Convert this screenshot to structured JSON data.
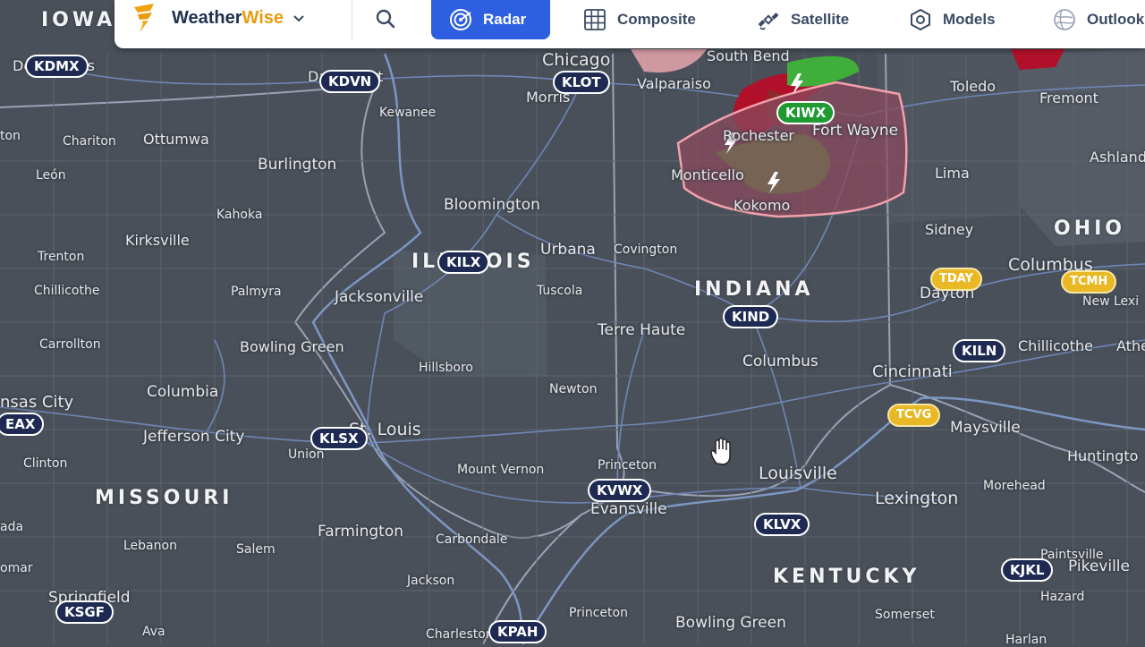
{
  "app": {
    "brand_part1": "Weather",
    "brand_part2": "Wise",
    "accent": "#2e5fe0",
    "brand_orange": "#e99b0e"
  },
  "nav": {
    "tabs": [
      {
        "label": "Radar",
        "icon": "radar-icon",
        "active": true
      },
      {
        "label": "Composite",
        "icon": "grid-icon"
      },
      {
        "label": "Satellite",
        "icon": "satellite-icon"
      },
      {
        "label": "Models",
        "icon": "models-icon"
      },
      {
        "label": "Outlook",
        "icon": "outlook-icon"
      }
    ]
  },
  "map": {
    "states": {
      "iowa": "IOWA",
      "illinois": "ILLINOIS",
      "indiana": "INDIANA",
      "ohio": "OHIO",
      "missouri": "MISSOURI",
      "kentucky": "KENTUCKY"
    },
    "cities": {
      "des_moines": "Des Moines",
      "davenport": "Davenport",
      "chicago": "Chicago",
      "south_bend": "South Bend",
      "valparaiso": "Valparaiso",
      "morris": "Morris",
      "toledo": "Toledo",
      "fremont": "Fremont",
      "kewanee": "Kewanee",
      "chariton": "Chariton",
      "ottumwa": "Ottumwa",
      "leon": "León",
      "burlington": "Burlington",
      "rochester": "Rochester",
      "fort_wayne": "Fort Wayne",
      "monticello": "Monticello",
      "kokomo": "Kokomo",
      "lima": "Lima",
      "ashland": "Ashland",
      "bloomington": "Bloomington",
      "kahoka": "Kahoka",
      "kirksville": "Kirksville",
      "trenton": "Trenton",
      "urbana": "Urbana",
      "covington": "Covington",
      "sidney": "Sidney",
      "columbus_oh": "Columbus",
      "chillicothe_mo": "Chillicothe",
      "palmyra": "Palmyra",
      "jacksonville": "Jacksonville",
      "tuscola": "Tuscola",
      "dayton": "Dayton",
      "new_lexington": "New Lexi",
      "carrollton": "Carrollton",
      "bowling_green_mo": "Bowling Green",
      "terre_haute": "Terre Haute",
      "chillicothe_oh": "Chillicothe",
      "athens": "Athe",
      "hillsboro": "Hillsboro",
      "columbus_in": "Columbus",
      "cincinnati": "Cincinnati",
      "kansas_city": "nsas City",
      "columbia": "Columbia",
      "newton": "Newton",
      "jefferson_city": "Jefferson City",
      "st_louis": "St. Louis",
      "union": "Union",
      "maysville": "Maysville",
      "huntington": "Huntingto",
      "clinton": "Clinton",
      "mount_vernon": "Mount Vernon",
      "princeton_in": "Princeton",
      "louisville": "Louisville",
      "morehead": "Morehead",
      "evansville": "Evansville",
      "lexington": "Lexington",
      "farmington": "Farmington",
      "carbondale": "Carbondale",
      "lebanon": "Lebanon",
      "salem": "Salem",
      "paintsville": "Paintsville",
      "ada": "ada",
      "omar": "omar",
      "springfield": "Springfield",
      "jackson": "Jackson",
      "pikeville": "Pikeville",
      "hazard": "Hazard",
      "princeton_ky": "Princeton",
      "somerset": "Somerset",
      "ava": "Ava",
      "charleston": "Charleston",
      "bowling_green_ky": "Bowling Green",
      "tonton": "ton",
      "harlan": "Harlan"
    },
    "stations": {
      "kdmx": "KDMX",
      "kdvn": "KDVN",
      "klot": "KLOT",
      "kiwx": "KIWX",
      "kilx": "KILX",
      "kind": "KIND",
      "tday": "TDAY",
      "tcmh": "TCMH",
      "kiln": "KILN",
      "eax": "EAX",
      "klsx": "KLSX",
      "tcvg": "TCVG",
      "kvwx": "KVWX",
      "klvx": "KLVX",
      "kjkl": "KJKL",
      "ksgf": "KSGF",
      "kpah": "KPAH"
    },
    "colors": {
      "background": "#4a5059",
      "road": "#6e86b8",
      "warning_fill": "#8a4a5e",
      "warning_border": "#f2a1ab",
      "radar_red": "#b0102a",
      "radar_green": "#3fae3a",
      "nexrad_badge": "#1e2a52",
      "tdwr_badge": "#e9b825",
      "active_badge": "#1f9a33"
    }
  }
}
